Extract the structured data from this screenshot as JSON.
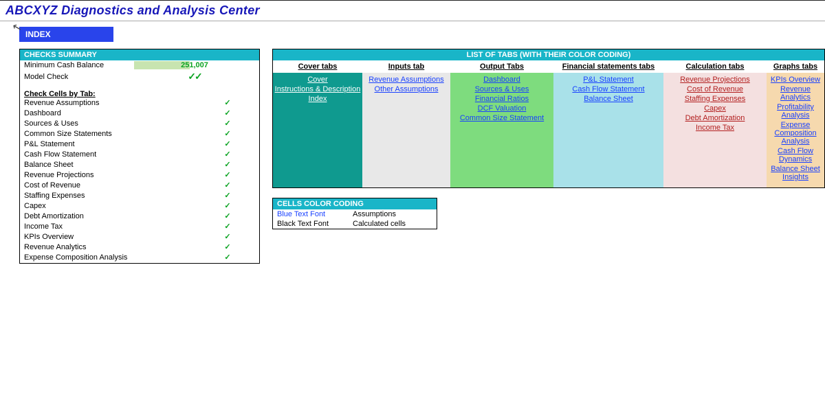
{
  "header": {
    "title": "ABCXYZ Diagnostics and Analysis Center",
    "index_label": "INDEX"
  },
  "checks_summary": {
    "heading": "CHECKS SUMMARY",
    "minimum_cash_balance": {
      "label": "Minimum Cash Balance",
      "value": "251,007"
    },
    "model_check": {
      "label": "Model Check"
    },
    "by_tab_heading": "Check Cells by Tab:",
    "tabs": [
      "Revenue Assumptions",
      "Dashboard",
      "Sources & Uses",
      "Common Size Statements",
      "P&L Statement",
      "Cash Flow Statement",
      "Balance Sheet",
      "Revenue Projections",
      "Cost of Revenue",
      "Staffing Expenses",
      "Capex",
      "Debt Amortization",
      "Income Tax",
      "KPIs Overview",
      "Revenue Analytics",
      "Expense Composition Analysis"
    ]
  },
  "tabs_panel": {
    "heading": "LIST OF TABS (WITH THEIR COLOR CODING)",
    "columns": [
      {
        "title": "Cover tabs",
        "bg": "bg-cover",
        "items": [
          "Cover",
          "Instructions & Description",
          "Index"
        ]
      },
      {
        "title": "Inputs tab",
        "bg": "bg-inputs",
        "items": [
          "Revenue Assumptions",
          "Other Assumptions"
        ]
      },
      {
        "title": "Output Tabs",
        "bg": "bg-output",
        "items": [
          "Dashboard",
          "Sources & Uses",
          "Financial Ratios",
          "DCF Valuation",
          "Common Size Statement"
        ]
      },
      {
        "title": "Financial statements tabs",
        "bg": "bg-fin",
        "items": [
          "P&L Statement",
          "Cash Flow Statement",
          "Balance Sheet"
        ]
      },
      {
        "title": "Calculation tabs",
        "bg": "bg-calc",
        "items": [
          "Revenue Projections",
          "Cost of Revenue",
          "Staffing Expenses",
          "Capex",
          "Debt Amortization",
          "Income Tax"
        ]
      },
      {
        "title": "Graphs tabs",
        "bg": "bg-graph",
        "items": [
          "KPIs Overview",
          "Revenue Analytics",
          "Profitability Analysis",
          "Expense Composition Analysis",
          "Cash Flow Dynamics",
          "Balance Sheet Insights"
        ]
      }
    ]
  },
  "color_coding": {
    "heading": "CELLS COLOR CODING",
    "rows": [
      {
        "font": "Blue Text Font",
        "meaning": "Assumptions",
        "blue": true
      },
      {
        "font": "Black Text Font",
        "meaning": "Calculated cells",
        "blue": false
      }
    ]
  }
}
